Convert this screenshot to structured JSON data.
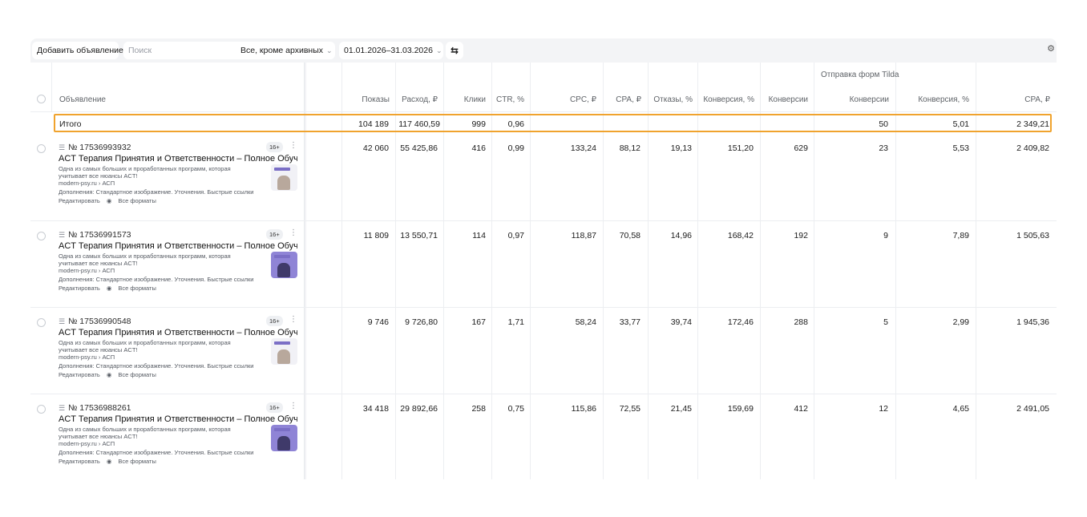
{
  "toolbar": {
    "add_label": "Добавить объявление",
    "search_placeholder": "Поиск",
    "filter_label": "Все, кроме архивных",
    "date_range": "01.01.2026–31.03.2026"
  },
  "table": {
    "group_header": "Отправка форм Tilda",
    "columns": {
      "ad": "Объявление",
      "impressions": "Показы",
      "spend": "Расход, ₽",
      "clicks": "Клики",
      "ctr": "CTR, %",
      "cpc": "CPC, ₽",
      "cpa": "CPA, ₽",
      "bounces": "Отказы, %",
      "conv_rate": "Конверсия, %",
      "conversions": "Конверсии",
      "tilda_conversions": "Конверсии",
      "tilda_conv_rate": "Конверсия, %",
      "tilda_cpa": "CPA, ₽"
    },
    "total": {
      "label": "Итого",
      "impressions": "104 189",
      "spend": "117 460,59",
      "clicks": "999",
      "ctr": "0,96",
      "tilda_conversions": "50",
      "tilda_conv_rate": "5,01",
      "tilda_cpa": "2 349,21"
    },
    "rows": [
      {
        "id": "№ 17536993932",
        "age": "16+",
        "title": "ACT Терапия Принятия и Ответственности – Полное Обучение – ...",
        "text1": "Одна из самых больших и проработанных программ, которая",
        "text2": "учитывает все нюансы ACT!",
        "domain": "modern-psy.ru › АСП",
        "extras": "Дополнения: Стандартное изображение. Уточнения. Быстрые ссылки",
        "edit": "Редактировать",
        "formats": "Все форматы",
        "impressions": "42 060",
        "spend": "55 425,86",
        "clicks": "416",
        "ctr": "0,99",
        "cpc": "133,24",
        "cpa": "88,12",
        "bounces": "19,13",
        "conv_rate": "151,20",
        "conversions": "629",
        "tilda_conversions": "23",
        "tilda_conv_rate": "5,53",
        "tilda_cpa": "2 409,82"
      },
      {
        "id": "№ 17536991573",
        "age": "16+",
        "title": "ACT Терапия Принятия и Ответственности – Полное Обучение – ...",
        "text1": "Одна из самых больших и проработанных программ, которая",
        "text2": "учитывает все нюансы ACT!",
        "domain": "modern-psy.ru › АСП",
        "extras": "Дополнения: Стандартное изображение. Уточнения. Быстрые ссылки",
        "edit": "Редактировать",
        "formats": "Все форматы",
        "impressions": "11 809",
        "spend": "13 550,71",
        "clicks": "114",
        "ctr": "0,97",
        "cpc": "118,87",
        "cpa": "70,58",
        "bounces": "14,96",
        "conv_rate": "168,42",
        "conversions": "192",
        "tilda_conversions": "9",
        "tilda_conv_rate": "7,89",
        "tilda_cpa": "1 505,63"
      },
      {
        "id": "№ 17536990548",
        "age": "16+",
        "title": "ACT Терапия Принятия и Ответственности – Полное Обучение – ...",
        "text1": "Одна из самых больших и проработанных программ, которая",
        "text2": "учитывает все нюансы ACT!",
        "domain": "modern-psy.ru › АСП",
        "extras": "Дополнения: Стандартное изображение. Уточнения. Быстрые ссылки",
        "edit": "Редактировать",
        "formats": "Все форматы",
        "impressions": "9 746",
        "spend": "9 726,80",
        "clicks": "167",
        "ctr": "1,71",
        "cpc": "58,24",
        "cpa": "33,77",
        "bounces": "39,74",
        "conv_rate": "172,46",
        "conversions": "288",
        "tilda_conversions": "5",
        "tilda_conv_rate": "2,99",
        "tilda_cpa": "1 945,36"
      },
      {
        "id": "№ 17536988261",
        "age": "16+",
        "title": "ACT Терапия Принятия и Ответственности – Полное Обучение – ...",
        "text1": "Одна из самых больших и проработанных программ, которая",
        "text2": "учитывает все нюансы ACT!",
        "domain": "modern-psy.ru › АСП",
        "extras": "Дополнения: Стандартное изображение. Уточнения. Быстрые ссылки",
        "edit": "Редактировать",
        "formats": "Все форматы",
        "impressions": "34 418",
        "spend": "29 892,66",
        "clicks": "258",
        "ctr": "0,75",
        "cpc": "115,86",
        "cpa": "72,55",
        "bounces": "21,45",
        "conv_rate": "159,69",
        "conversions": "412",
        "tilda_conversions": "12",
        "tilda_conv_rate": "4,65",
        "tilda_cpa": "2 491,05"
      }
    ]
  },
  "colors": {
    "accent_total_border": "#f0a32e",
    "toolbar_bg": "#f3f4f6",
    "thumbnail_purple": "#7b6fc6"
  }
}
